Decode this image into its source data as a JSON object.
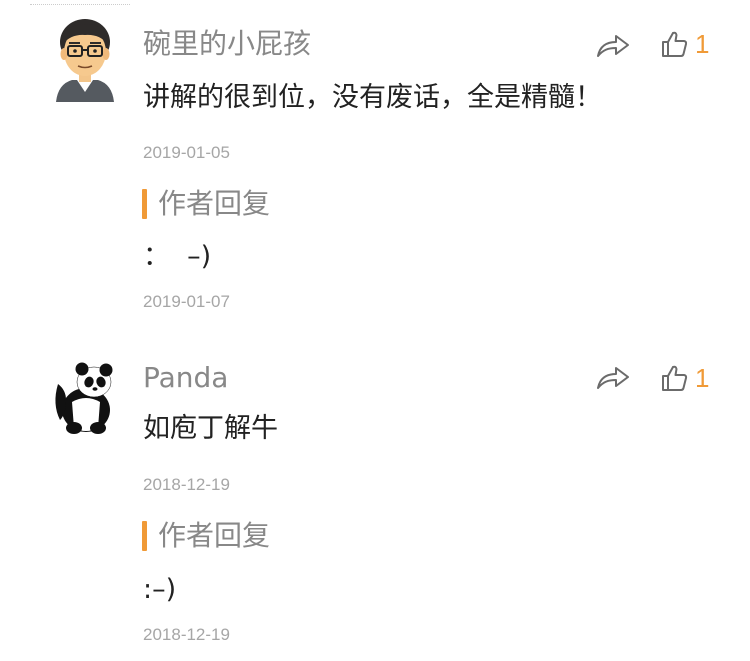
{
  "comments": [
    {
      "avatar": "cartoon-man-with-glasses",
      "username": "碗里的小屁孩",
      "content": "讲解的很到位，没有废话，全是精髓！",
      "date": "2019-01-05",
      "like_count": "1",
      "reply": {
        "title": "作者回复",
        "content": "：  –)",
        "date": "2019-01-07"
      }
    },
    {
      "avatar": "panda",
      "username": "Panda",
      "content": "如庖丁解牛",
      "date": "2018-12-19",
      "like_count": "1",
      "reply": {
        "title": "作者回复",
        "content": ":–)",
        "date": "2018-12-19"
      }
    }
  ],
  "icons": {
    "share": "share-arrow-icon",
    "like": "thumbs-up-icon"
  },
  "colors": {
    "accent": "#f09a37",
    "username": "#888888",
    "text": "#222222",
    "date": "#a6a6a6",
    "icon": "#6b6b6b"
  }
}
